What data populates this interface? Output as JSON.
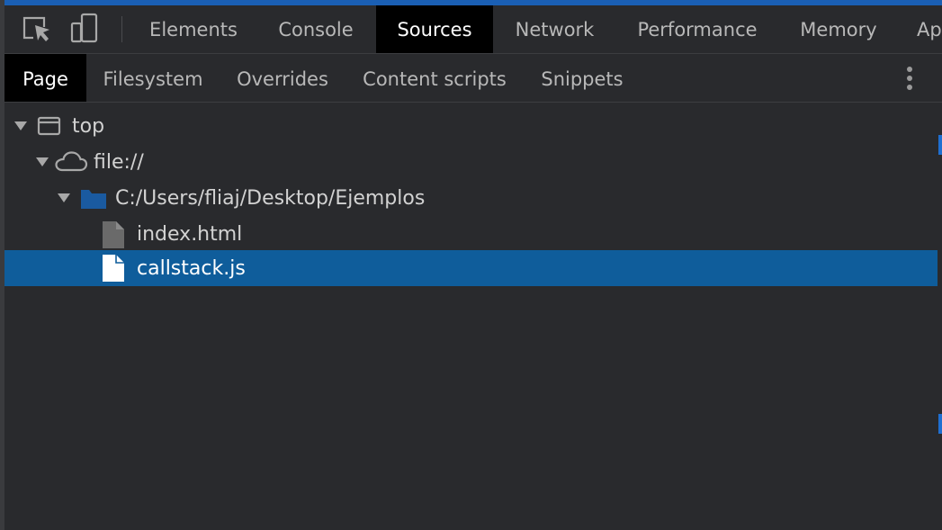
{
  "toolbar": {
    "inspect_icon": "inspect-element-icon",
    "device_icon": "device-toolbar-icon",
    "tabs": [
      {
        "label": "Elements"
      },
      {
        "label": "Console"
      },
      {
        "label": "Sources"
      },
      {
        "label": "Network"
      },
      {
        "label": "Performance"
      },
      {
        "label": "Memory"
      },
      {
        "label": "Ap"
      }
    ],
    "active_tab": "Sources"
  },
  "subtabs": {
    "items": [
      {
        "label": "Page"
      },
      {
        "label": "Filesystem"
      },
      {
        "label": "Overrides"
      },
      {
        "label": "Content scripts"
      },
      {
        "label": "Snippets"
      }
    ],
    "active": "Page",
    "menu_icon": "more-options-icon"
  },
  "tree": {
    "items": [
      {
        "label": "top",
        "icon": "frame-icon",
        "expanded": true
      },
      {
        "label": "file://",
        "icon": "cloud-icon",
        "expanded": true
      },
      {
        "label": "C:/Users/fliaj/Desktop/Ejemplos",
        "icon": "folder-icon",
        "expanded": true
      },
      {
        "label": "index.html",
        "icon": "file-icon"
      },
      {
        "label": "callstack.js",
        "icon": "file-icon",
        "selected": true
      }
    ]
  },
  "colors": {
    "background": "#292a2d",
    "active_tab_bg": "#000000",
    "selection": "#0f5d9b",
    "folder": "#1a5aa0",
    "accent_strip": "#1a5fb4"
  }
}
